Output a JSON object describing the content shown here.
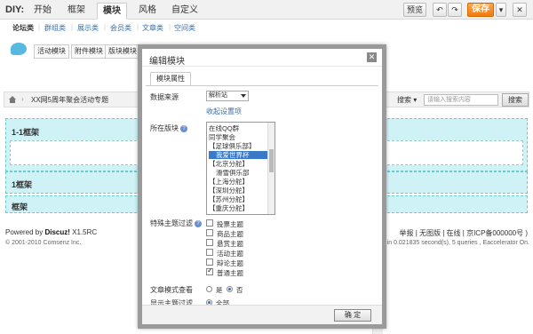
{
  "diybar": {
    "logo": "DIY:",
    "tabs": [
      "开始",
      "框架",
      "模块",
      "风格",
      "自定义"
    ],
    "active_tab": "模块",
    "preview": "预览",
    "save": "保存",
    "undo_icon": "undo-icon",
    "redo_icon": "redo-icon"
  },
  "categories": [
    "论坛类",
    "群组类",
    "展示类",
    "会员类",
    "文章类",
    "空间类"
  ],
  "modules": {
    "icon": "speech-bubble-icon",
    "items": [
      "活动模块",
      "附件模块",
      "版块模块",
      "帖"
    ]
  },
  "crumbbar": {
    "home_icon": "home-icon",
    "crumb": "XX网5周年聚会活动专题",
    "search_label": "搜索",
    "search_placeholder": "请输入搜索内容",
    "search_button": "搜索"
  },
  "frames": {
    "f1": "1-1框架",
    "f2": "1框架",
    "f3": "框架"
  },
  "footer": {
    "powered": "Powered by",
    "brand": "Discuz!",
    "version": " X1.5RC",
    "copyright": "© 2001-2010 Comsenz Inc.",
    "right_links": "举报 | 无图版 | 在线 | 京ICP备000000号 )",
    "processed": "ssed in 0.021835 second(s), 5 queries , Eaccelerator On."
  },
  "dialog": {
    "title": "编辑模块",
    "subtab": "模块属性",
    "data_source_label": "数据来源",
    "data_source_value": "解析站",
    "collapse_link": "收起设置项",
    "board_label": "所在版块",
    "boards": [
      "在线QQ群",
      "同学聚会",
      "【足球俱乐部】",
      "我爱世界杯",
      "【北京分舵】",
      "滑雪俱乐部",
      "【上海分舵】",
      "【深圳分舵】",
      "【苏州分舵】",
      "【重庆分舵】"
    ],
    "selected_board": "我爱世界杯",
    "special_label": "特殊主题过滤",
    "special_options": [
      "投票主题",
      "商品主题",
      "悬赏主题",
      "活动主题",
      "辩论主题",
      "普通主题"
    ],
    "special_checked": "普通主题",
    "article_mode_label": "文章模式查看",
    "article_yes": "是",
    "article_no": "否",
    "more_label": "显示主题过滤",
    "more_value": "全部",
    "ok_button": "确 定",
    "close_icon": "close-icon"
  }
}
